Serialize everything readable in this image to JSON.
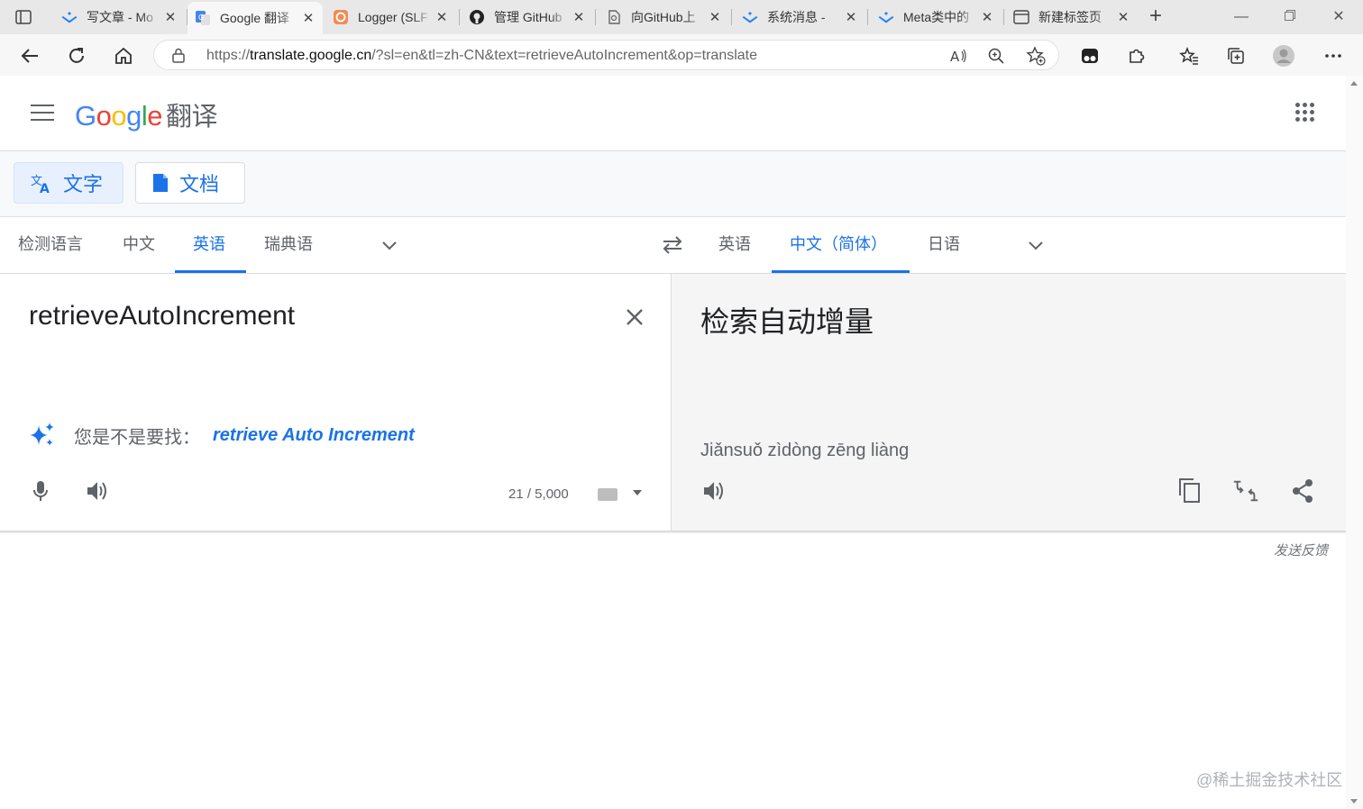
{
  "browser": {
    "tabs": [
      {
        "title": "写文章 - Mo",
        "icon": "juejin-icon",
        "active": false
      },
      {
        "title": "Google 翻译",
        "icon": "google-translate-icon",
        "active": true
      },
      {
        "title": "Logger (SLF",
        "icon": "logger-icon",
        "active": false
      },
      {
        "title": "管理 GitHub",
        "icon": "github-icon",
        "active": false
      },
      {
        "title": "向GitHub上",
        "icon": "page-icon",
        "active": false
      },
      {
        "title": "系统消息 -",
        "icon": "juejin-icon",
        "active": false
      },
      {
        "title": "Meta类中的",
        "icon": "juejin-icon",
        "active": false
      },
      {
        "title": "新建标签页",
        "icon": "newtab-page-icon",
        "active": false
      }
    ],
    "address": {
      "prefix": "https://",
      "host": "translate.google.cn",
      "path": "/?sl=en&tl=zh-CN&text=retrieveAutoIncrement&op=translate"
    }
  },
  "header": {
    "logo_letters": [
      "G",
      "o",
      "o",
      "g",
      "l",
      "e"
    ],
    "product": "翻译"
  },
  "modes": [
    {
      "label": "文字",
      "active": true
    },
    {
      "label": "文档",
      "active": false
    }
  ],
  "source_langs": [
    "检测语言",
    "中文",
    "英语",
    "瑞典语"
  ],
  "source_selected": "英语",
  "target_langs": [
    "英语",
    "中文（简体）",
    "日语"
  ],
  "target_selected": "中文（简体）",
  "source": {
    "text": "retrieveAutoIncrement",
    "did_you_mean_label": "您是不是要找：",
    "suggestion": "retrieve Auto Increment",
    "char_count": "21 / 5,000"
  },
  "target": {
    "text": "检索自动增量",
    "romanization": "Jiǎnsuǒ zìdòng zēng liàng"
  },
  "footer": {
    "feedback": "发送反馈",
    "watermark": "@稀土掘金技术社区"
  },
  "colors": {
    "accent": "#1a73e8",
    "tab_bar": "#e8e8e8",
    "target_pane": "#f5f5f5"
  }
}
